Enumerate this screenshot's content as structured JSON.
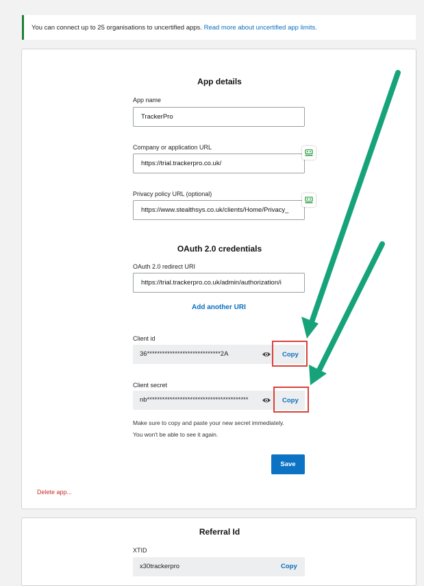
{
  "banner": {
    "text": "You can connect up to 25 organisations to uncertified apps.",
    "link": "Read more about uncertified app limits."
  },
  "app_details": {
    "title": "App details",
    "app_name_label": "App name",
    "app_name_value": "TrackerPro",
    "company_url_label": "Company or application URL",
    "company_url_value": "https://trial.trackerpro.co.uk/",
    "privacy_url_label": "Privacy policy URL (optional)",
    "privacy_url_value": "https://www.stealthsys.co.uk/clients/Home/Privacy_"
  },
  "oauth": {
    "title": "OAuth 2.0 credentials",
    "redirect_label": "OAuth 2.0 redirect URI",
    "redirect_value": "https://trial.trackerpro.co.uk/admin/authorization/i",
    "add_uri_link": "Add another URI",
    "client_id_label": "Client id",
    "client_id_value": "36*****************************2A",
    "client_secret_label": "Client secret",
    "client_secret_value": "nb****************************************",
    "copy_label": "Copy",
    "note_line1": "Make sure to copy and paste your new secret immediately.",
    "note_line2": "You won't be able to see it again."
  },
  "actions": {
    "save_label": "Save",
    "delete_label": "Delete app..."
  },
  "referral": {
    "title": "Referral Id",
    "xtid_label": "XTID",
    "xtid_value": "x30trackerpro",
    "copy_label": "Copy"
  },
  "icons": {
    "eye": "eye-icon",
    "password_manager": "password-manager-icon"
  },
  "colors": {
    "accent": "#0a6ebd",
    "save_button": "#0b72c4",
    "delete": "#c9302c",
    "highlight": "#d9413b",
    "annotation_arrow": "#17a37a",
    "banner_border": "#1e7e34"
  }
}
